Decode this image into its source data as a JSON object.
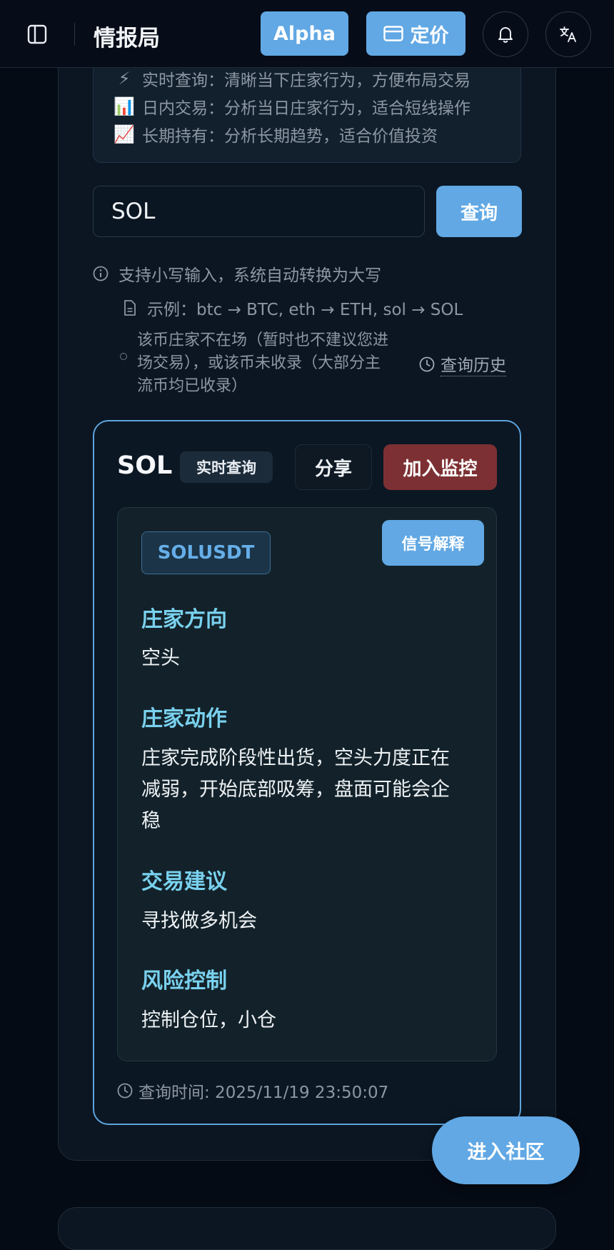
{
  "header": {
    "title": "情报局",
    "alpha_label": "Alpha",
    "pricing_label": "定价",
    "sidebar_icon": "sidebar-toggle-icon",
    "bell_icon": "bell-icon",
    "translate_icon": "translate-icon"
  },
  "modes": [
    {
      "icon": "⚡",
      "text": "实时查询：清晰当下庄家行为，方便布局交易"
    },
    {
      "icon": "📊",
      "text": "日内交易：分析当日庄家行为，适合短线操作"
    },
    {
      "icon": "📈",
      "text": "长期持有：分析长期趋势，适合价值投资"
    }
  ],
  "search": {
    "value": "SOL",
    "button_label": "查询"
  },
  "hints": {
    "lowercase": "支持小写输入，系统自动转换为大写",
    "example": "示例：btc → BTC, eth → ETH, sol → SOL",
    "not_listed": "该币庄家不在场（暂时也不建议您进场交易），或该币未收录（大部分主流币均已收录）",
    "history_label": "查询历史"
  },
  "result": {
    "symbol": "SOL",
    "mode_badge": "实时查询",
    "share_label": "分享",
    "monitor_label": "加入监控",
    "pair": "SOLUSDT",
    "explain_label": "信号解释",
    "sections": [
      {
        "title": "庄家方向",
        "body": "空头"
      },
      {
        "title": "庄家动作",
        "body": "庄家完成阶段性出货，空头力度正在减弱，开始底部吸筹，盘面可能会企稳"
      },
      {
        "title": "交易建议",
        "body": "寻找做多机会"
      },
      {
        "title": "风险控制",
        "body": "控制仓位，小仓"
      }
    ],
    "query_time": "查询时间: 2025/11/19 23:50:07"
  },
  "community_label": "进入社区",
  "colors": {
    "accent": "#61a8e4",
    "danger": "#7d3033",
    "section_title": "#79d1ee",
    "background": "#050b15"
  }
}
